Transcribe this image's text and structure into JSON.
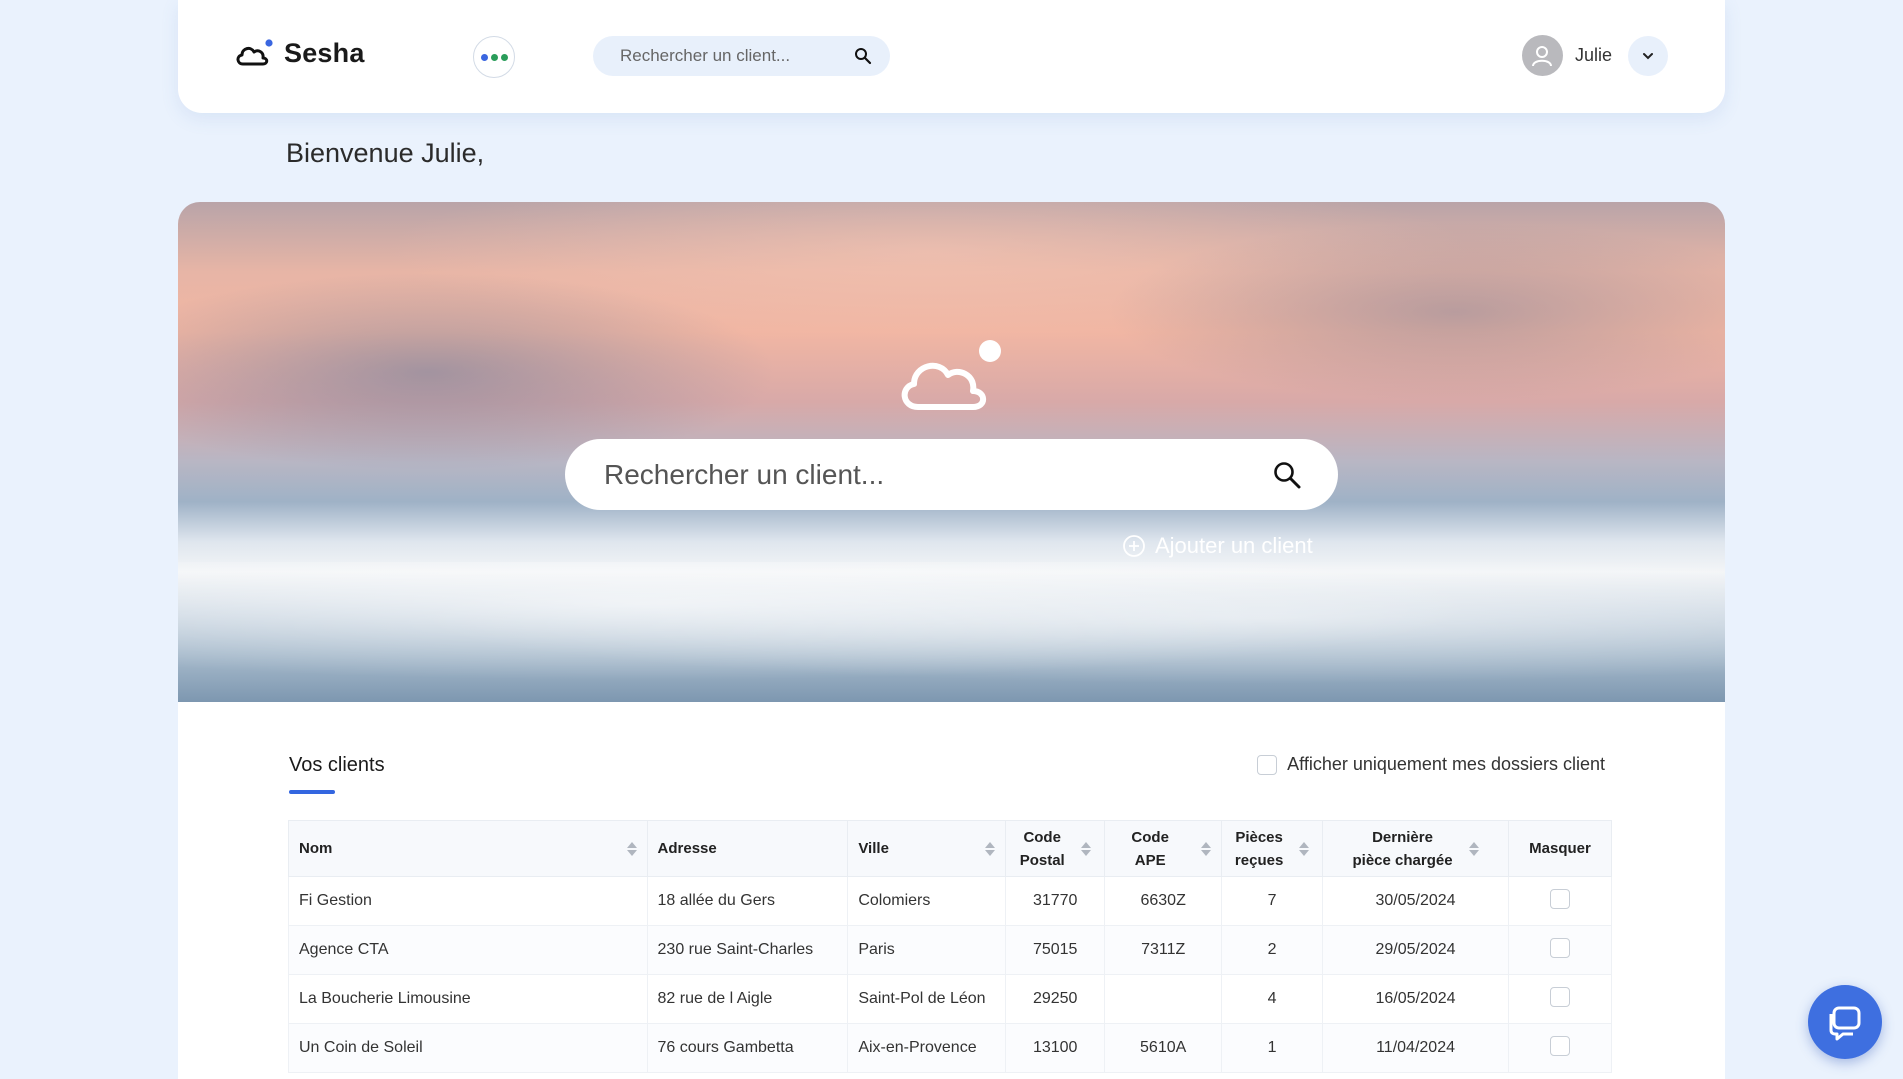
{
  "brand": {
    "name": "Sesha",
    "logo_icon": "cloud-icon",
    "dot_color": "#3a66e0"
  },
  "header": {
    "apps_dots": [
      "#3a66e0",
      "#2a9d5a",
      "#2a9d5a"
    ],
    "search_placeholder": "Rechercher un client...",
    "user_name": "Julie"
  },
  "welcome": "Bienvenue Julie,",
  "hero": {
    "search_placeholder": "Rechercher un client...",
    "add_client_label": "Ajouter un client"
  },
  "clients": {
    "title": "Vos clients",
    "filter_label": "Afficher uniquement mes dossiers client",
    "columns": {
      "nom": "Nom",
      "adresse": "Adresse",
      "ville": "Ville",
      "code_postal_1": "Code",
      "code_postal_2": "Postal",
      "code_ape": "Code APE",
      "pieces_1": "Pièces",
      "pieces_2": "reçues",
      "derniere_1": "Dernière",
      "derniere_2": "pièce chargée",
      "masquer": "Masquer"
    },
    "rows": [
      {
        "nom": "Fi Gestion",
        "adresse": "18 allée du Gers",
        "ville": "Colomiers",
        "code_postal": "31770",
        "code_ape": "6630Z",
        "pieces": "7",
        "derniere": "30/05/2024"
      },
      {
        "nom": "Agence CTA",
        "adresse": "230 rue Saint-Charles",
        "ville": "Paris",
        "code_postal": "75015",
        "code_ape": "7311Z",
        "pieces": "2",
        "derniere": "29/05/2024"
      },
      {
        "nom": "La Boucherie Limousine",
        "adresse": "82 rue de l Aigle",
        "ville": "Saint-Pol de Léon",
        "code_postal": "29250",
        "code_ape": "",
        "pieces": "4",
        "derniere": "16/05/2024"
      },
      {
        "nom": "Un Coin de Soleil",
        "adresse": "76 cours Gambetta",
        "ville": "Aix-en-Provence",
        "code_postal": "13100",
        "code_ape": "5610A",
        "pieces": "1",
        "derniere": "11/04/2024"
      }
    ]
  },
  "colors": {
    "accent": "#3366e0",
    "background": "#eaf2fd"
  }
}
